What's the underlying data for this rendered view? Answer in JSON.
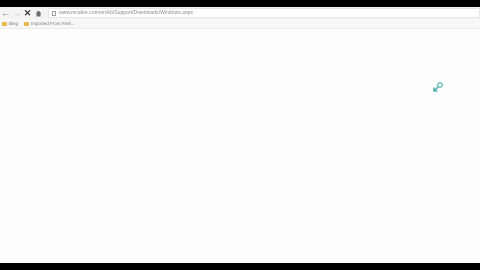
{
  "toolbar": {
    "back_icon": "back-arrow-icon",
    "forward_icon": "forward-arrow-icon",
    "stop_icon": "stop-icon",
    "home_icon": "home-icon"
  },
  "omnibox": {
    "url": "www.mcafee.com/en/kb/Support/Downloads/Windows.aspx"
  },
  "bookmarks": {
    "items": [
      {
        "label": "Bing"
      },
      {
        "label": "Imported From Firef..."
      }
    ]
  },
  "colors": {
    "bookmark_folder": "#e8b84a",
    "page_background": "#fdfdfd",
    "loading_indicator": "#3aa7a0"
  }
}
